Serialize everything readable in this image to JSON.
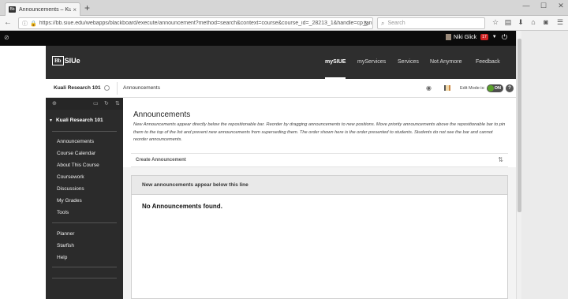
{
  "browser": {
    "tab_title": "Announcements – Kuali R...",
    "tab_close": "×",
    "new_tab": "+",
    "win": {
      "min": "—",
      "max": "☐",
      "close": "✕"
    },
    "back": "←",
    "forward": "→",
    "url": "https://bb.siue.edu/webapps/blackboard/execute/announcement?method=search&context=course&course_id=_28213_1&handle=cp_announce",
    "reload": "↻",
    "search_placeholder": "Search",
    "icons": {
      "star": "☆",
      "reading": "▤",
      "download": "⬇",
      "home": "⌂",
      "pocket": "◙",
      "menu": "☰"
    }
  },
  "bb_top": {
    "left_icon": "⊘",
    "user_name": "Niki Glick",
    "notifications": "17",
    "caret": "▼",
    "power": "⏻"
  },
  "bb_nav": {
    "logo_bb": "Bb",
    "logo_siue": "SIUe",
    "tabs": [
      "mySIUE",
      "myServices",
      "Services",
      "Not Anymore",
      "Feedback"
    ],
    "active_tab": "mySIUE"
  },
  "crumb": {
    "course": "Kuali Research 101",
    "page": "Announcements",
    "edit_mode_label": "Edit Mode is:",
    "edit_mode_value": "ON",
    "help": "?"
  },
  "sidebar": {
    "title": "Kuali Research 101",
    "caret": "▼",
    "tools": [
      "⊕",
      "▭",
      "↻",
      "⇅"
    ],
    "group1": [
      "Announcements",
      "Course Calendar",
      "About This Course",
      "Coursework",
      "Discussions",
      "My Grades",
      "Tools"
    ],
    "group2": [
      "Planner",
      "Starfish",
      "Help"
    ]
  },
  "main": {
    "title": "Announcements",
    "description": "New Announcements appear directly below the repositionable bar. Reorder by dragging announcements to new positions. Move priority announcements above the repositionable bar to pin them to the top of the list and prevent new announcements from superseding them. The order shown here is the order presented to students. Students do not see the bar and cannot reorder announcements.",
    "create_label": "Create Announcement",
    "sort_icon": "⇅",
    "panel_header": "New announcements appear below this line",
    "empty_text": "No Announcements found."
  }
}
